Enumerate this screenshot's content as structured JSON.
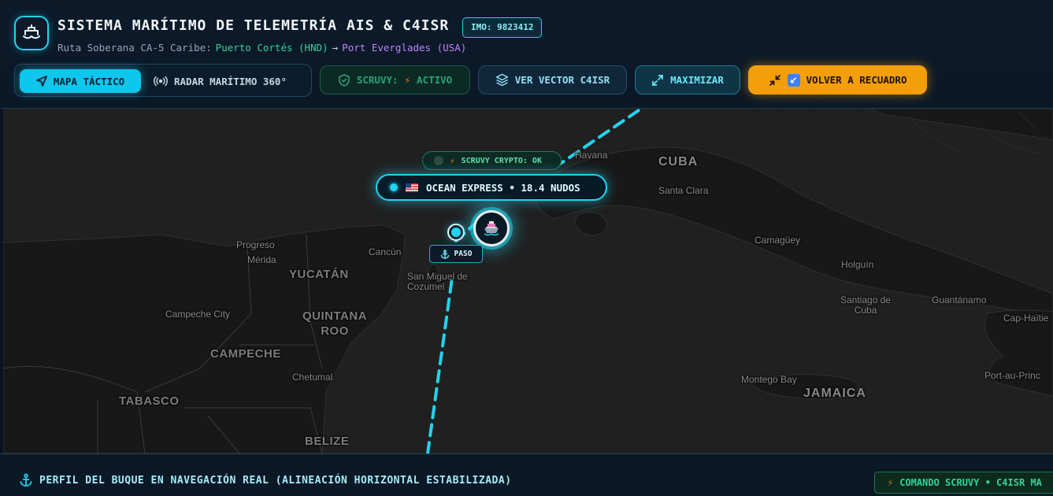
{
  "header": {
    "title": "SISTEMA MARÍTIMO DE TELEMETRÍA AIS & C4ISR",
    "imo_badge": "IMO: 9823412",
    "route_prefix": "Ruta Soberana CA-5 Caribe:",
    "route_origin": "Puerto Cortés (HND)",
    "route_arrow": "→",
    "route_destination": "Port Everglades (USA)"
  },
  "toolbar": {
    "tab_map": "MAPA TÁCTICO",
    "tab_radar": "RADAR MARÍTIMO 360°",
    "scruvy_label": "SCRUVY:",
    "scruvy_status": "ACTIVO",
    "vector_label": "VER VECTOR C4ISR",
    "maximize_label": "MAXIMIZAR",
    "recenter_label": "VOLVER A RECUADRO"
  },
  "map": {
    "crypto_status": "SCRUVY CRYPTO: OK",
    "vessel_label": "OCEAN EXPRESS • 18.4 NUDOS",
    "waypoint_label": "PASO",
    "labels": {
      "havana": "Havana",
      "cuba": "CUBA",
      "santa_clara": "Santa Clara",
      "camaguey": "Camagüey",
      "holguin": "Holguín",
      "santiago": "Santiago de\nCuba",
      "guantanamo": "Guantánamo",
      "cap_haitien": "Cap-Haïtien",
      "cap_trunc": "Cap-Haïtie",
      "port_au_prince": "Port-au-Prince",
      "port_trunc": "Port-au-Princ",
      "montego": "Montego Bay",
      "jamaica": "JAMAICA",
      "progreso": "Progreso",
      "merida": "Mérida",
      "cancun": "Cancún",
      "yucatan": "YUCATÁN",
      "san_miguel": "San Miguel de\nCozumel",
      "campeche_city": "Campeche City",
      "quintana": "QUINTANA\nROO",
      "campeche": "CAMPECHE",
      "chetumal": "Chetumal",
      "tabasco": "TABASCO",
      "belize": "BELIZE"
    }
  },
  "footer": {
    "title": "PERFIL DEL BUQUE EN NAVEGACIÓN REAL (ALINEACIÓN HORIZONTAL ESTABILIZADA)",
    "badge": "COMANDO SCRUVY • C4ISR MA"
  },
  "colors": {
    "accent": "#22d3ee",
    "warning": "#f59e0b",
    "success": "#34d399",
    "destination": "#c084fc"
  }
}
